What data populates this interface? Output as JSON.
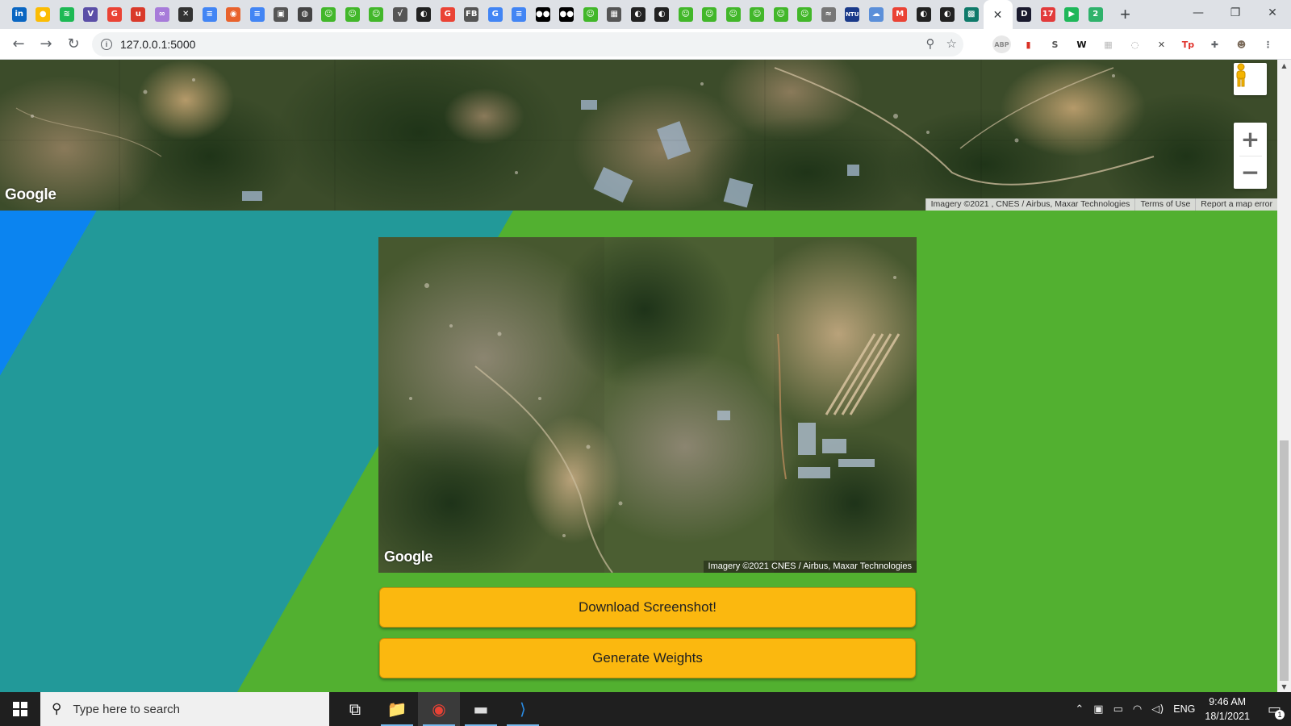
{
  "browser": {
    "tabs": [
      {
        "icon": "linkedin-icon",
        "glyph": "in",
        "color": "#0a66c2"
      },
      {
        "icon": "keep-icon",
        "glyph": "●",
        "color": "#fbbc04"
      },
      {
        "icon": "spotify-icon",
        "glyph": "≋",
        "color": "#1db954"
      },
      {
        "icon": "v-app-icon",
        "glyph": "V",
        "color": "#5b4fa7"
      },
      {
        "icon": "google-icon",
        "glyph": "G",
        "color": "#ea4335"
      },
      {
        "icon": "u-app-icon",
        "glyph": "u",
        "color": "#d93a2b"
      },
      {
        "icon": "link-icon",
        "glyph": "∞",
        "color": "#a77bd9"
      },
      {
        "icon": "scissors-icon",
        "glyph": "✕",
        "color": "#333333"
      },
      {
        "icon": "docs-icon",
        "glyph": "≡",
        "color": "#4285f4"
      },
      {
        "icon": "bag-icon",
        "glyph": "◉",
        "color": "#e8622c"
      },
      {
        "icon": "docs-icon",
        "glyph": "≡",
        "color": "#4285f4"
      },
      {
        "icon": "photo-icon",
        "glyph": "▣",
        "color": "#555555"
      },
      {
        "icon": "globe-icon",
        "glyph": "◍",
        "color": "#444444"
      },
      {
        "icon": "smiley-icon",
        "glyph": "☺",
        "color": "#42b72a"
      },
      {
        "icon": "smiley-icon",
        "glyph": "☺",
        "color": "#42b72a"
      },
      {
        "icon": "smiley-icon",
        "glyph": "☺",
        "color": "#42b72a"
      },
      {
        "icon": "check-doc-icon",
        "glyph": "√",
        "color": "#555555"
      },
      {
        "icon": "github-icon",
        "glyph": "◐",
        "color": "#222222"
      },
      {
        "icon": "google-icon",
        "glyph": "G",
        "color": "#ea4335"
      },
      {
        "icon": "fb-icon",
        "glyph": "FB",
        "color": "#555555"
      },
      {
        "icon": "google-icon",
        "glyph": "G",
        "color": "#4285f4"
      },
      {
        "icon": "docs-icon",
        "glyph": "≡",
        "color": "#4285f4"
      },
      {
        "icon": "medium-icon",
        "glyph": "●●",
        "color": "#000000"
      },
      {
        "icon": "medium-icon",
        "glyph": "●●",
        "color": "#000000"
      },
      {
        "icon": "smiley-icon",
        "glyph": "☺",
        "color": "#42b72a"
      },
      {
        "icon": "table-icon",
        "glyph": "▦",
        "color": "#555555"
      },
      {
        "icon": "github-icon",
        "glyph": "◐",
        "color": "#222222"
      },
      {
        "icon": "github-icon",
        "glyph": "◐",
        "color": "#222222"
      },
      {
        "icon": "smiley-icon",
        "glyph": "☺",
        "color": "#42b72a"
      },
      {
        "icon": "smiley-icon",
        "glyph": "☺",
        "color": "#42b72a"
      },
      {
        "icon": "smiley-icon",
        "glyph": "☺",
        "color": "#42b72a"
      },
      {
        "icon": "smiley-icon",
        "glyph": "☺",
        "color": "#42b72a"
      },
      {
        "icon": "smiley-icon",
        "glyph": "☺",
        "color": "#42b72a"
      },
      {
        "icon": "smiley-icon",
        "glyph": "☺",
        "color": "#42b72a"
      },
      {
        "icon": "grad-icon",
        "glyph": "≈",
        "color": "#777777"
      },
      {
        "icon": "ntu-icon",
        "glyph": "NTU",
        "color": "#1a3a8a"
      },
      {
        "icon": "cloud-icon",
        "glyph": "☁",
        "color": "#5b8fd9"
      },
      {
        "icon": "gmail-icon",
        "glyph": "M",
        "color": "#ea4335"
      },
      {
        "icon": "github-icon",
        "glyph": "◐",
        "color": "#222222"
      },
      {
        "icon": "github-icon",
        "glyph": "◐",
        "color": "#222222"
      },
      {
        "icon": "chip-icon",
        "glyph": "▩",
        "color": "#0f7a6a"
      }
    ],
    "active_tab_close": "✕",
    "after_tabs": [
      {
        "icon": "d-app-icon",
        "glyph": "D",
        "color": "#1a1a2e"
      },
      {
        "icon": "calendar-icon",
        "glyph": "17",
        "color": "#e23b3b"
      },
      {
        "icon": "play-icon",
        "glyph": "▶",
        "color": "#1fb75a"
      },
      {
        "icon": "two-icon",
        "glyph": "2",
        "color": "#2fb26b"
      }
    ],
    "new_tab": "+",
    "window": {
      "minimize": "—",
      "restore": "❐",
      "close": "✕"
    },
    "nav": {
      "back": "←",
      "forward": "→",
      "reload": "↻"
    },
    "url": "127.0.0.1:5000",
    "omni_icons": {
      "location": "⚲",
      "bookmark": "☆"
    },
    "extensions": [
      {
        "icon": "adblock-icon",
        "glyph": "ABP",
        "color": "#888888"
      },
      {
        "icon": "bookmark-red-icon",
        "glyph": "▮",
        "color": "#d93025"
      },
      {
        "icon": "skype-icon",
        "glyph": "S",
        "color": "#555555"
      },
      {
        "icon": "w-icon",
        "glyph": "W",
        "color": "#111111"
      },
      {
        "icon": "ext-grid-icon",
        "glyph": "▦",
        "color": "#bbbbbb"
      },
      {
        "icon": "ext-circle-icon",
        "glyph": "◌",
        "color": "#999999"
      },
      {
        "icon": "x-ext-icon",
        "glyph": "✕",
        "color": "#444444"
      },
      {
        "icon": "tp-icon",
        "glyph": "Tp",
        "color": "#e0322b"
      },
      {
        "icon": "puzzle-icon",
        "glyph": "✚",
        "color": "#5f6368"
      },
      {
        "icon": "profile-icon",
        "glyph": "☻",
        "color": "#7a6a5a"
      },
      {
        "icon": "menu-icon",
        "glyph": "⋮",
        "color": "#5f6368"
      }
    ]
  },
  "page": {
    "top_map": {
      "logo": "Google",
      "attribution": "Imagery ©2021 , CNES / Airbus, Maxar Technologies",
      "terms": "Terms of Use",
      "report": "Report a map error",
      "zoom_in": "+",
      "zoom_out": "−"
    },
    "screenshot_map": {
      "logo": "Google",
      "attribution": "Imagery ©2021 CNES / Airbus, Maxar Technologies"
    },
    "buttons": {
      "download": "Download Screenshot!",
      "generate": "Generate Weights"
    },
    "colors": {
      "background": "#52b030",
      "teal": "#229999",
      "blue": "#0b84f0",
      "button": "#fbb80f"
    }
  },
  "taskbar": {
    "search_placeholder": "Type here to search",
    "apps": [
      {
        "icon": "task-view-icon",
        "glyph": "⧉",
        "active": false
      },
      {
        "icon": "file-explorer-icon",
        "glyph": "📁",
        "active": false
      },
      {
        "icon": "chrome-icon",
        "glyph": "◉",
        "active": true
      },
      {
        "icon": "terminal-icon",
        "glyph": "▬",
        "active": false
      },
      {
        "icon": "vscode-icon",
        "glyph": "⟩",
        "active": false
      }
    ],
    "tray": {
      "language": "ENG",
      "time": "9:46 AM",
      "date": "18/1/2021",
      "notifications": "1"
    }
  }
}
